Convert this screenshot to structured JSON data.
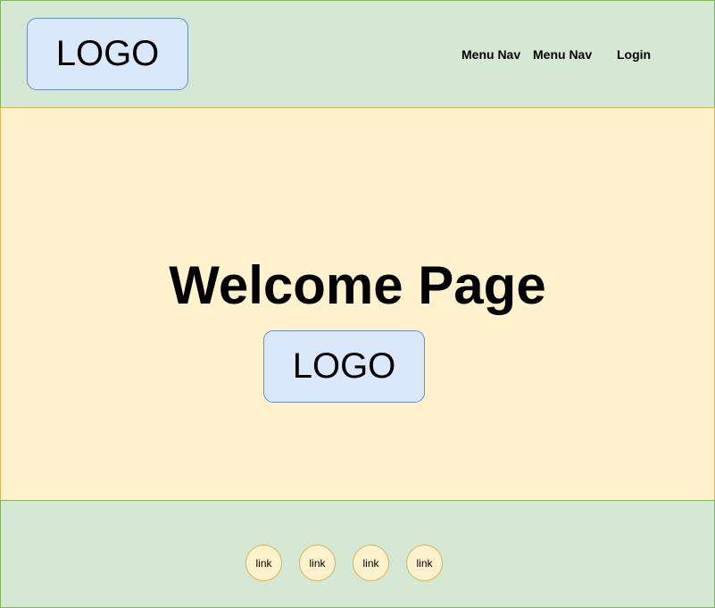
{
  "header": {
    "logo": "LOGO",
    "nav": [
      "Menu Nav",
      "Menu Nav",
      "Login"
    ]
  },
  "main": {
    "title": "Welcome Page",
    "logo": "LOGO"
  },
  "footer": {
    "links": [
      "link",
      "link",
      "link",
      "link"
    ]
  },
  "colors": {
    "header_fill": "#d5e8d4",
    "header_border": "#82b366",
    "main_fill": "#fff2cc",
    "main_border": "#d6b656",
    "logo_fill": "#dae8fc",
    "logo_border": "#6c8ebf"
  }
}
